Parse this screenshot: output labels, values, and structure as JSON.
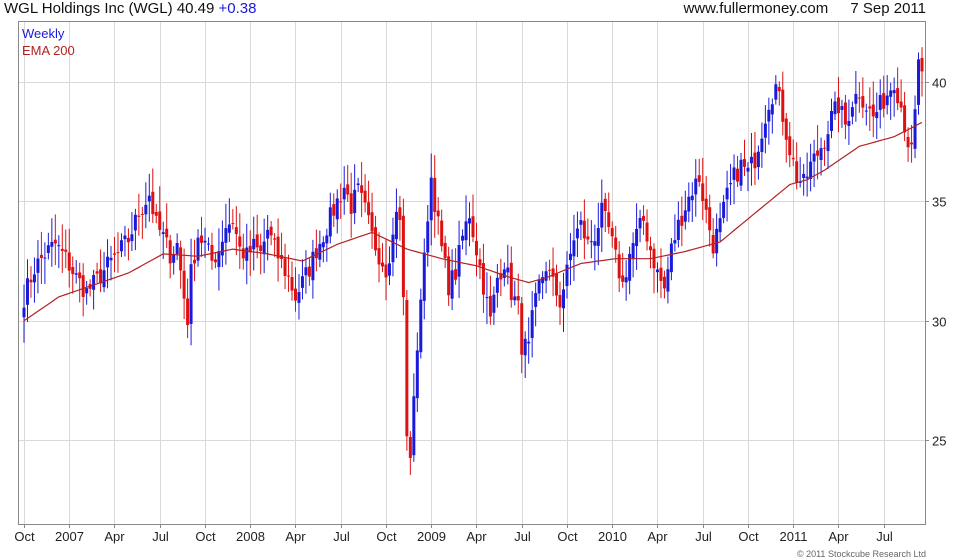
{
  "header": {
    "title": "WGL Holdings Inc (WGL) 40.49",
    "change": "+0.38",
    "site": "www.fullermoney.com",
    "date": "7 Sep 2011"
  },
  "legend": {
    "period": "Weekly",
    "indicator": "EMA 200"
  },
  "copyright": "© 2011 Stockcube Research Ltd",
  "colors": {
    "up": "#1a1adb",
    "down": "#dd1111",
    "ema": "#b22222",
    "grid": "#d9d9d9",
    "frame": "#888888"
  },
  "chart_data": {
    "type": "candlestick",
    "ylim": [
      21.5,
      42.5
    ],
    "yticks": [
      25,
      30,
      35,
      40
    ],
    "grid": true,
    "xlabels": [
      "Oct",
      "2007",
      "Apr",
      "Jul",
      "Oct",
      "2008",
      "Apr",
      "Jul",
      "Oct",
      "2009",
      "Apr",
      "Jul",
      "Oct",
      "2010",
      "Apr",
      "Jul",
      "Oct",
      "2011",
      "Apr",
      "Jul"
    ],
    "x_label_positions": [
      0,
      13,
      26,
      39,
      52,
      65,
      78,
      91,
      104,
      117,
      130,
      143,
      156,
      169,
      182,
      195,
      208,
      221,
      234,
      247
    ],
    "weeks": 259,
    "close_keypoints": [
      [
        0,
        31.0
      ],
      [
        3,
        32.2
      ],
      [
        6,
        32.8
      ],
      [
        9,
        33.2
      ],
      [
        12,
        32.6
      ],
      [
        15,
        31.8
      ],
      [
        18,
        31.2
      ],
      [
        21,
        31.7
      ],
      [
        24,
        32.3
      ],
      [
        27,
        32.8
      ],
      [
        30,
        33.4
      ],
      [
        33,
        34.5
      ],
      [
        36,
        35.3
      ],
      [
        38,
        34.0
      ],
      [
        40,
        33.5
      ],
      [
        42,
        32.8
      ],
      [
        44,
        33.2
      ],
      [
        46,
        31.0
      ],
      [
        47,
        30.1
      ],
      [
        48,
        32.0
      ],
      [
        50,
        33.6
      ],
      [
        52,
        33.2
      ],
      [
        54,
        32.5
      ],
      [
        56,
        33.0
      ],
      [
        58,
        34.0
      ],
      [
        60,
        34.2
      ],
      [
        62,
        33.0
      ],
      [
        64,
        32.7
      ],
      [
        66,
        33.1
      ],
      [
        68,
        32.8
      ],
      [
        70,
        33.8
      ],
      [
        72,
        33.0
      ],
      [
        74,
        32.4
      ],
      [
        76,
        31.8
      ],
      [
        78,
        31.0
      ],
      [
        80,
        31.6
      ],
      [
        82,
        32.2
      ],
      [
        84,
        33.0
      ],
      [
        86,
        33.6
      ],
      [
        88,
        34.3
      ],
      [
        90,
        35.0
      ],
      [
        92,
        35.6
      ],
      [
        94,
        34.8
      ],
      [
        96,
        35.4
      ],
      [
        98,
        34.6
      ],
      [
        100,
        33.5
      ],
      [
        102,
        32.8
      ],
      [
        104,
        32.2
      ],
      [
        106,
        33.5
      ],
      [
        107,
        34.8
      ],
      [
        108,
        34.0
      ],
      [
        109,
        31.0
      ],
      [
        110,
        25.0
      ],
      [
        111,
        24.5
      ],
      [
        112,
        26.5
      ],
      [
        113,
        29.0
      ],
      [
        114,
        31.0
      ],
      [
        115,
        32.5
      ],
      [
        116,
        34.5
      ],
      [
        117,
        36.0
      ],
      [
        118,
        35.0
      ],
      [
        120,
        33.0
      ],
      [
        122,
        31.5
      ],
      [
        124,
        32.0
      ],
      [
        126,
        33.5
      ],
      [
        128,
        34.5
      ],
      [
        130,
        33.0
      ],
      [
        132,
        31.5
      ],
      [
        134,
        30.0
      ],
      [
        136,
        31.8
      ],
      [
        138,
        32.5
      ],
      [
        140,
        31.2
      ],
      [
        142,
        30.5
      ],
      [
        143,
        29.0
      ],
      [
        145,
        28.8
      ],
      [
        146,
        30.0
      ],
      [
        148,
        31.5
      ],
      [
        150,
        32.3
      ],
      [
        152,
        31.5
      ],
      [
        154,
        30.8
      ],
      [
        156,
        32.0
      ],
      [
        158,
        33.5
      ],
      [
        160,
        34.0
      ],
      [
        162,
        33.2
      ],
      [
        164,
        33.6
      ],
      [
        166,
        34.5
      ],
      [
        168,
        33.8
      ],
      [
        170,
        32.6
      ],
      [
        172,
        31.5
      ],
      [
        174,
        32.8
      ],
      [
        176,
        33.6
      ],
      [
        178,
        34.2
      ],
      [
        180,
        33.0
      ],
      [
        182,
        32.0
      ],
      [
        184,
        31.3
      ],
      [
        186,
        33.0
      ],
      [
        188,
        34.0
      ],
      [
        190,
        34.8
      ],
      [
        192,
        35.5
      ],
      [
        194,
        36.0
      ],
      [
        196,
        34.5
      ],
      [
        198,
        33.2
      ],
      [
        200,
        34.0
      ],
      [
        202,
        35.2
      ],
      [
        204,
        36.0
      ],
      [
        206,
        36.5
      ],
      [
        208,
        36.2
      ],
      [
        210,
        36.8
      ],
      [
        212,
        38.0
      ],
      [
        214,
        39.2
      ],
      [
        216,
        39.8
      ],
      [
        218,
        38.6
      ],
      [
        220,
        37.2
      ],
      [
        222,
        36.0
      ],
      [
        224,
        35.7
      ],
      [
        226,
        36.5
      ],
      [
        228,
        37.0
      ],
      [
        230,
        37.6
      ],
      [
        232,
        38.5
      ],
      [
        234,
        39.0
      ],
      [
        236,
        38.2
      ],
      [
        238,
        39.2
      ],
      [
        240,
        39.6
      ],
      [
        242,
        39.0
      ],
      [
        244,
        38.5
      ],
      [
        246,
        39.0
      ],
      [
        248,
        39.5
      ],
      [
        250,
        40.1
      ],
      [
        252,
        39.0
      ],
      [
        254,
        37.5
      ],
      [
        255,
        37.0
      ],
      [
        256,
        38.6
      ],
      [
        257,
        40.7
      ],
      [
        258,
        40.49
      ]
    ],
    "ema_keypoints": [
      [
        0,
        30.0
      ],
      [
        10,
        31.0
      ],
      [
        20,
        31.5
      ],
      [
        30,
        32.0
      ],
      [
        40,
        32.8
      ],
      [
        50,
        32.7
      ],
      [
        60,
        33.0
      ],
      [
        70,
        32.8
      ],
      [
        80,
        32.5
      ],
      [
        90,
        33.2
      ],
      [
        100,
        33.7
      ],
      [
        110,
        33.0
      ],
      [
        120,
        32.6
      ],
      [
        130,
        32.3
      ],
      [
        140,
        31.8
      ],
      [
        145,
        31.6
      ],
      [
        150,
        31.8
      ],
      [
        160,
        32.4
      ],
      [
        170,
        32.6
      ],
      [
        180,
        32.6
      ],
      [
        190,
        32.9
      ],
      [
        200,
        33.3
      ],
      [
        210,
        34.5
      ],
      [
        220,
        35.7
      ],
      [
        225,
        35.9
      ],
      [
        230,
        36.3
      ],
      [
        240,
        37.3
      ],
      [
        250,
        37.7
      ],
      [
        258,
        38.3
      ]
    ]
  }
}
